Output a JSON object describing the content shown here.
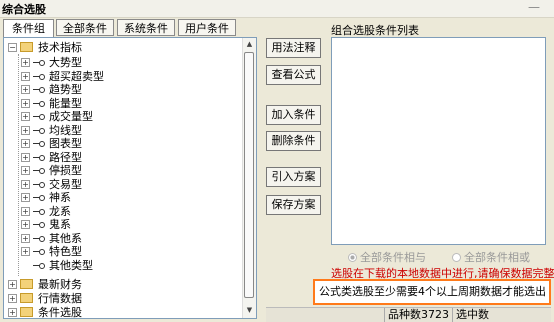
{
  "window": {
    "title": "综合选股",
    "minimize": "—"
  },
  "tabs": [
    {
      "label": "条件组",
      "active": true
    },
    {
      "label": "全部条件",
      "active": false
    },
    {
      "label": "系统条件",
      "active": false
    },
    {
      "label": "用户条件",
      "active": false
    }
  ],
  "tree": {
    "root": {
      "label": "技术指标",
      "expander": "−"
    },
    "children": [
      {
        "label": "大势型",
        "expander": "+"
      },
      {
        "label": "超买超卖型",
        "expander": "+"
      },
      {
        "label": "趋势型",
        "expander": "+"
      },
      {
        "label": "能量型",
        "expander": "+"
      },
      {
        "label": "成交量型",
        "expander": "+"
      },
      {
        "label": "均线型",
        "expander": "+"
      },
      {
        "label": "图表型",
        "expander": "+"
      },
      {
        "label": "路径型",
        "expander": "+"
      },
      {
        "label": "停损型",
        "expander": "+"
      },
      {
        "label": "交易型",
        "expander": "+"
      },
      {
        "label": "神系",
        "expander": "+"
      },
      {
        "label": "龙系",
        "expander": "+"
      },
      {
        "label": "鬼系",
        "expander": "+"
      },
      {
        "label": "其他系",
        "expander": "+"
      },
      {
        "label": "特色型",
        "expander": "+"
      },
      {
        "label": "其他类型",
        "expander": ""
      }
    ],
    "folders": [
      {
        "label": "最新财务",
        "expander": "+"
      },
      {
        "label": "行情数据",
        "expander": "+"
      },
      {
        "label": "条件选股",
        "expander": "+"
      }
    ]
  },
  "buttons": {
    "usage": "用法注释",
    "view_formula": "查看公式",
    "add_condition": "加入条件",
    "delete_condition": "删除条件",
    "import_plan": "引入方案",
    "save_plan": "保存方案"
  },
  "list": {
    "label": "组合选股条件列表"
  },
  "radios": {
    "and_label": "全部条件相与",
    "or_label": "全部条件相或"
  },
  "red_text": "选股在下载的本地数据中进行,请确保数据完整",
  "notice": "公式类选股至少需要4个以上周期数据才能选出",
  "status": {
    "count_label": "品种数",
    "count_value": "3723",
    "selected_label": "选中数"
  }
}
